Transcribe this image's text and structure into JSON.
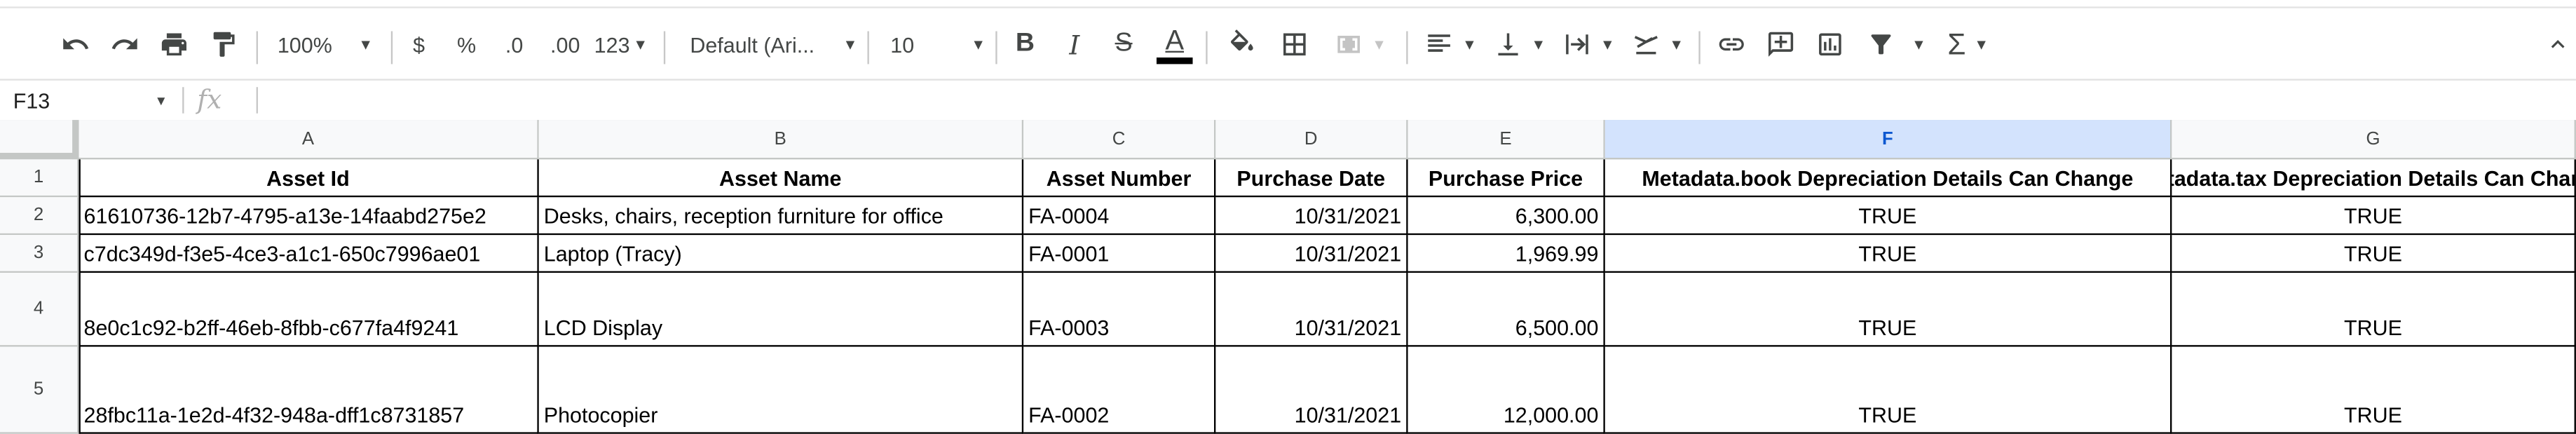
{
  "toolbar": {
    "zoom": "100%",
    "currency": "$",
    "percent": "%",
    "dec_decrease": ".0",
    "dec_increase": ".00",
    "number_format": "123",
    "font": "Default (Ari...",
    "font_size": "10",
    "bold": "B",
    "italic": "I",
    "strike": "S",
    "text_color_glyph": "A",
    "sum_glyph": "Σ"
  },
  "formula_bar": {
    "cell_ref": "F13",
    "fx": "fx",
    "value": ""
  },
  "columns": [
    "A",
    "B",
    "C",
    "D",
    "E",
    "F",
    "G"
  ],
  "rows": [
    "1",
    "2",
    "3",
    "4",
    "5"
  ],
  "headers": [
    "Asset Id",
    "Asset Name",
    "Asset Number",
    "Purchase Date",
    "Purchase Price",
    "Metadata.book Depreciation Details Can Change",
    "Metadata.tax Depreciation Details Can Change"
  ],
  "data": [
    [
      "61610736-12b7-4795-a13e-14faabd275e2",
      "Desks, chairs, reception furniture for office",
      "FA-0004",
      "10/31/2021",
      "6,300.00",
      "TRUE",
      "TRUE"
    ],
    [
      "c7dc349d-f3e5-4ce3-a1c1-650c7996ae01",
      "Laptop (Tracy)",
      "FA-0001",
      "10/31/2021",
      "1,969.99",
      "TRUE",
      "TRUE"
    ],
    [
      "8e0c1c92-b2ff-46eb-8fbb-c677fa4f9241",
      "LCD Display",
      "FA-0003",
      "10/31/2021",
      "6,500.00",
      "TRUE",
      "TRUE"
    ],
    [
      "28fbc11a-1e2d-4f32-948a-dff1c8731857",
      "Photocopier",
      "FA-0002",
      "10/31/2021",
      "12,000.00",
      "TRUE",
      "TRUE"
    ]
  ],
  "selected_column": "F"
}
